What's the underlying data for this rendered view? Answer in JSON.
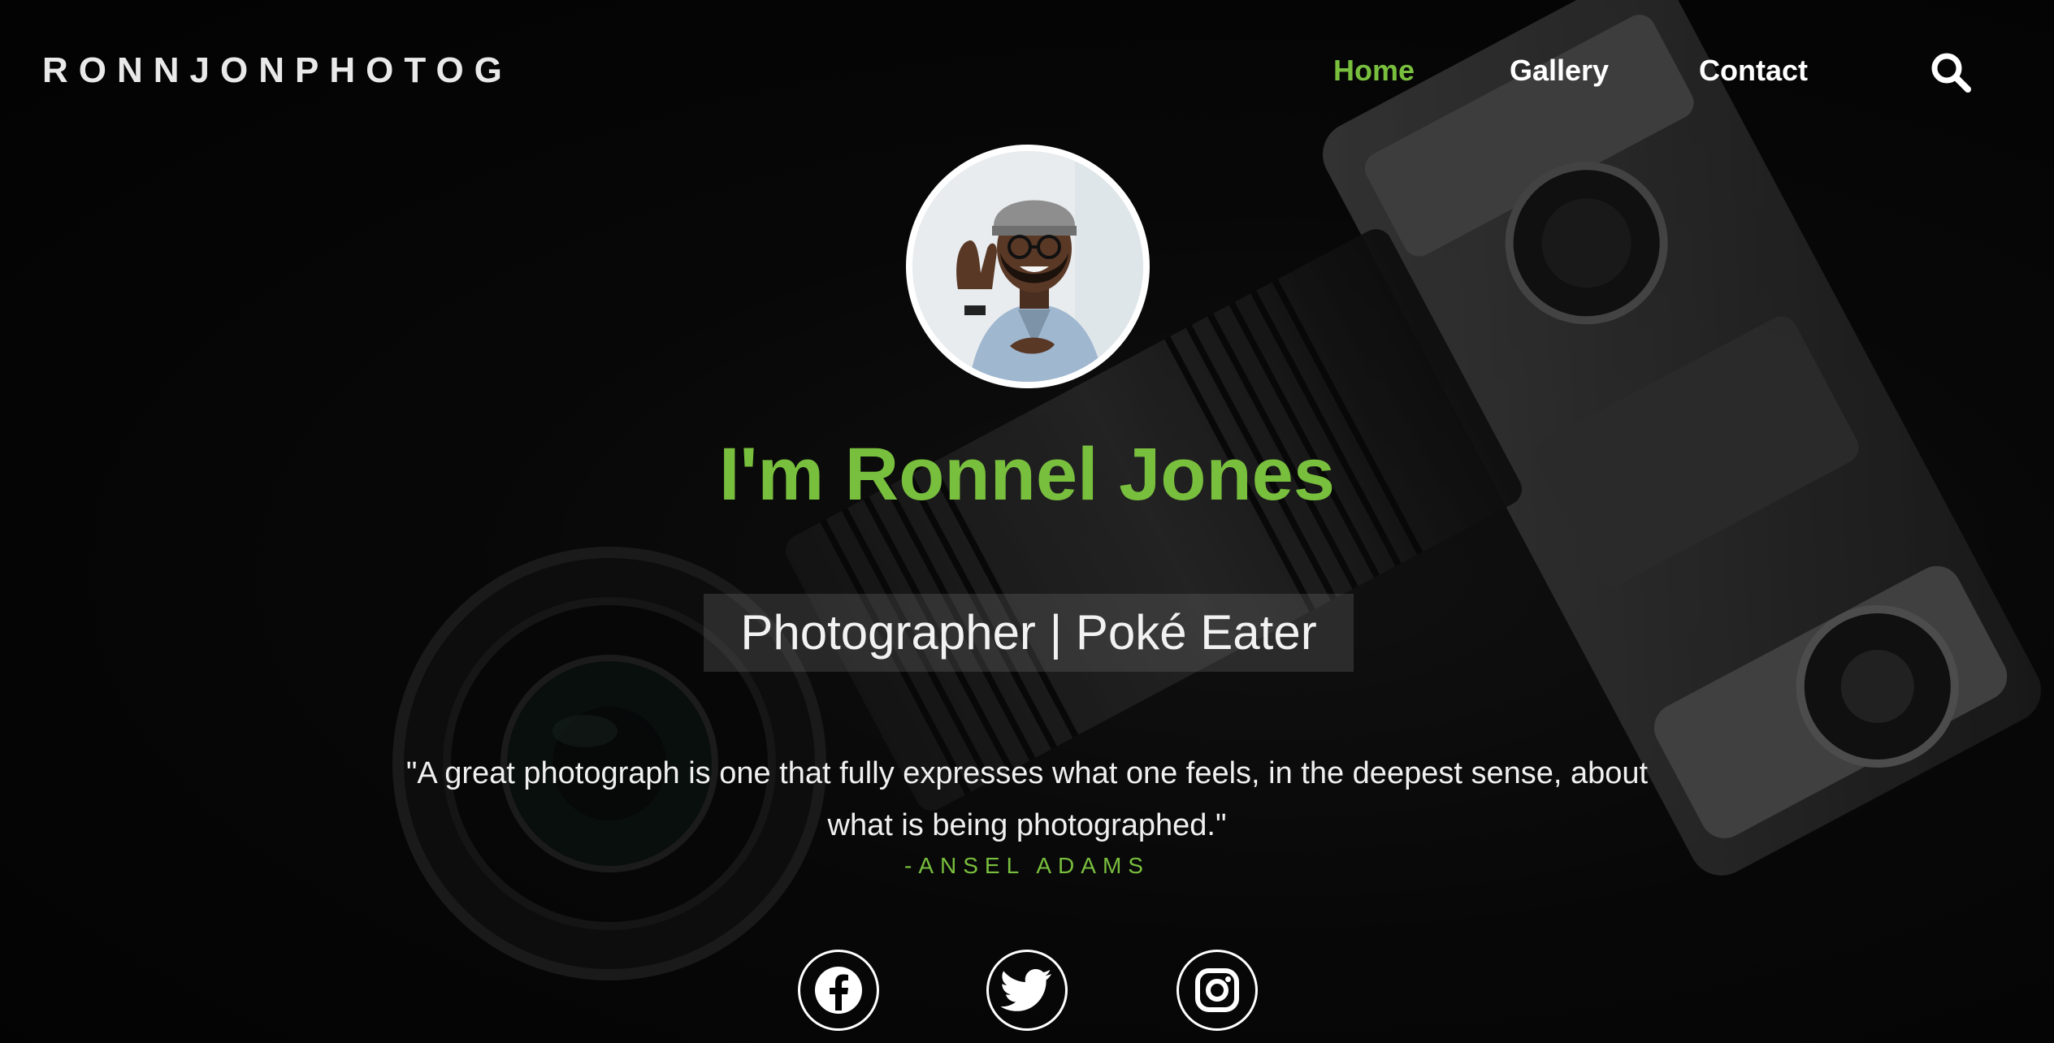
{
  "brand": {
    "name": "RONNJONPHOTOG"
  },
  "nav": {
    "items": [
      {
        "label": "Home",
        "active": true
      },
      {
        "label": "Gallery",
        "active": false
      },
      {
        "label": "Contact",
        "active": false
      }
    ],
    "search_icon": "search-icon"
  },
  "profile": {
    "avatar_icon": "avatar",
    "heading": "I'm Ronnel Jones",
    "tagline": "Photographer | Poké Eater"
  },
  "quote": {
    "text": "\"A great photograph is one that fully expresses what one feels, in the deepest sense, about what is being photographed.\"",
    "author": "-ANSEL ADAMS"
  },
  "social": [
    {
      "icon": "facebook-icon"
    },
    {
      "icon": "twitter-icon"
    },
    {
      "icon": "instagram-icon"
    }
  ],
  "colors": {
    "accent": "#79bf3e",
    "background": "#070707",
    "text": "#ffffff"
  }
}
